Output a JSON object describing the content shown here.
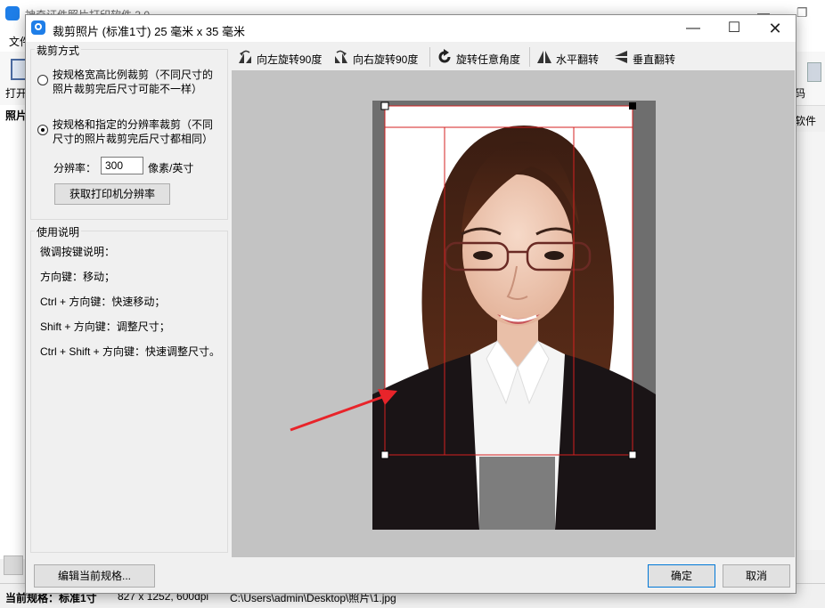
{
  "background_app": {
    "title": "神奇证件照片打印软件 3.0",
    "menu_file": "文件",
    "toolbar_open": "打开",
    "toolbar_right_label": "码",
    "panel_photo_label": "照片",
    "right_panel_label": "软件",
    "status": {
      "spec_label": "当前规格：",
      "spec_value": "标准1寸",
      "size_info": "827 x 1252, 600dpi",
      "file_path": "C:\\Users\\admin\\Desktop\\照片\\1.jpg"
    }
  },
  "dialog": {
    "title": "裁剪照片 (标准1寸) 25 毫米 x 35 毫米",
    "crop_mode": {
      "legend": "裁剪方式",
      "option1_line1": "按规格宽高比例裁剪（不同尺寸的",
      "option1_line2": "照片裁剪完后尺寸可能不一样）",
      "option1_selected": false,
      "option2_line1": "按规格和指定的分辨率裁剪（不同",
      "option2_line2": "尺寸的照片裁剪完后尺寸都相同）",
      "option2_selected": true,
      "resolution_label": "分辨率：",
      "resolution_value": "300",
      "resolution_unit": "像素/英寸",
      "get_printer_resolution": "获取打印机分辨率"
    },
    "instructions": {
      "legend": "使用说明",
      "lines": [
        "微调按键说明：",
        "方向键：移动；",
        "Ctrl + 方向键：快速移动；",
        "Shift + 方向键：调整尺寸；",
        "Ctrl + Shift + 方向键：快速调整尺寸。"
      ]
    },
    "toolbar": {
      "rotate_left": "向左旋转90度",
      "rotate_right": "向右旋转90度",
      "rotate_any": "旋转任意角度",
      "flip_horizontal": "水平翻转",
      "flip_vertical": "垂直翻转"
    },
    "buttons": {
      "edit_spec": "编辑当前规格...",
      "ok": "确定",
      "cancel": "取消"
    }
  },
  "colors": {
    "crop_line": "#d42020",
    "arrow": "#e8242a",
    "app_blue": "#1e7ee8"
  }
}
